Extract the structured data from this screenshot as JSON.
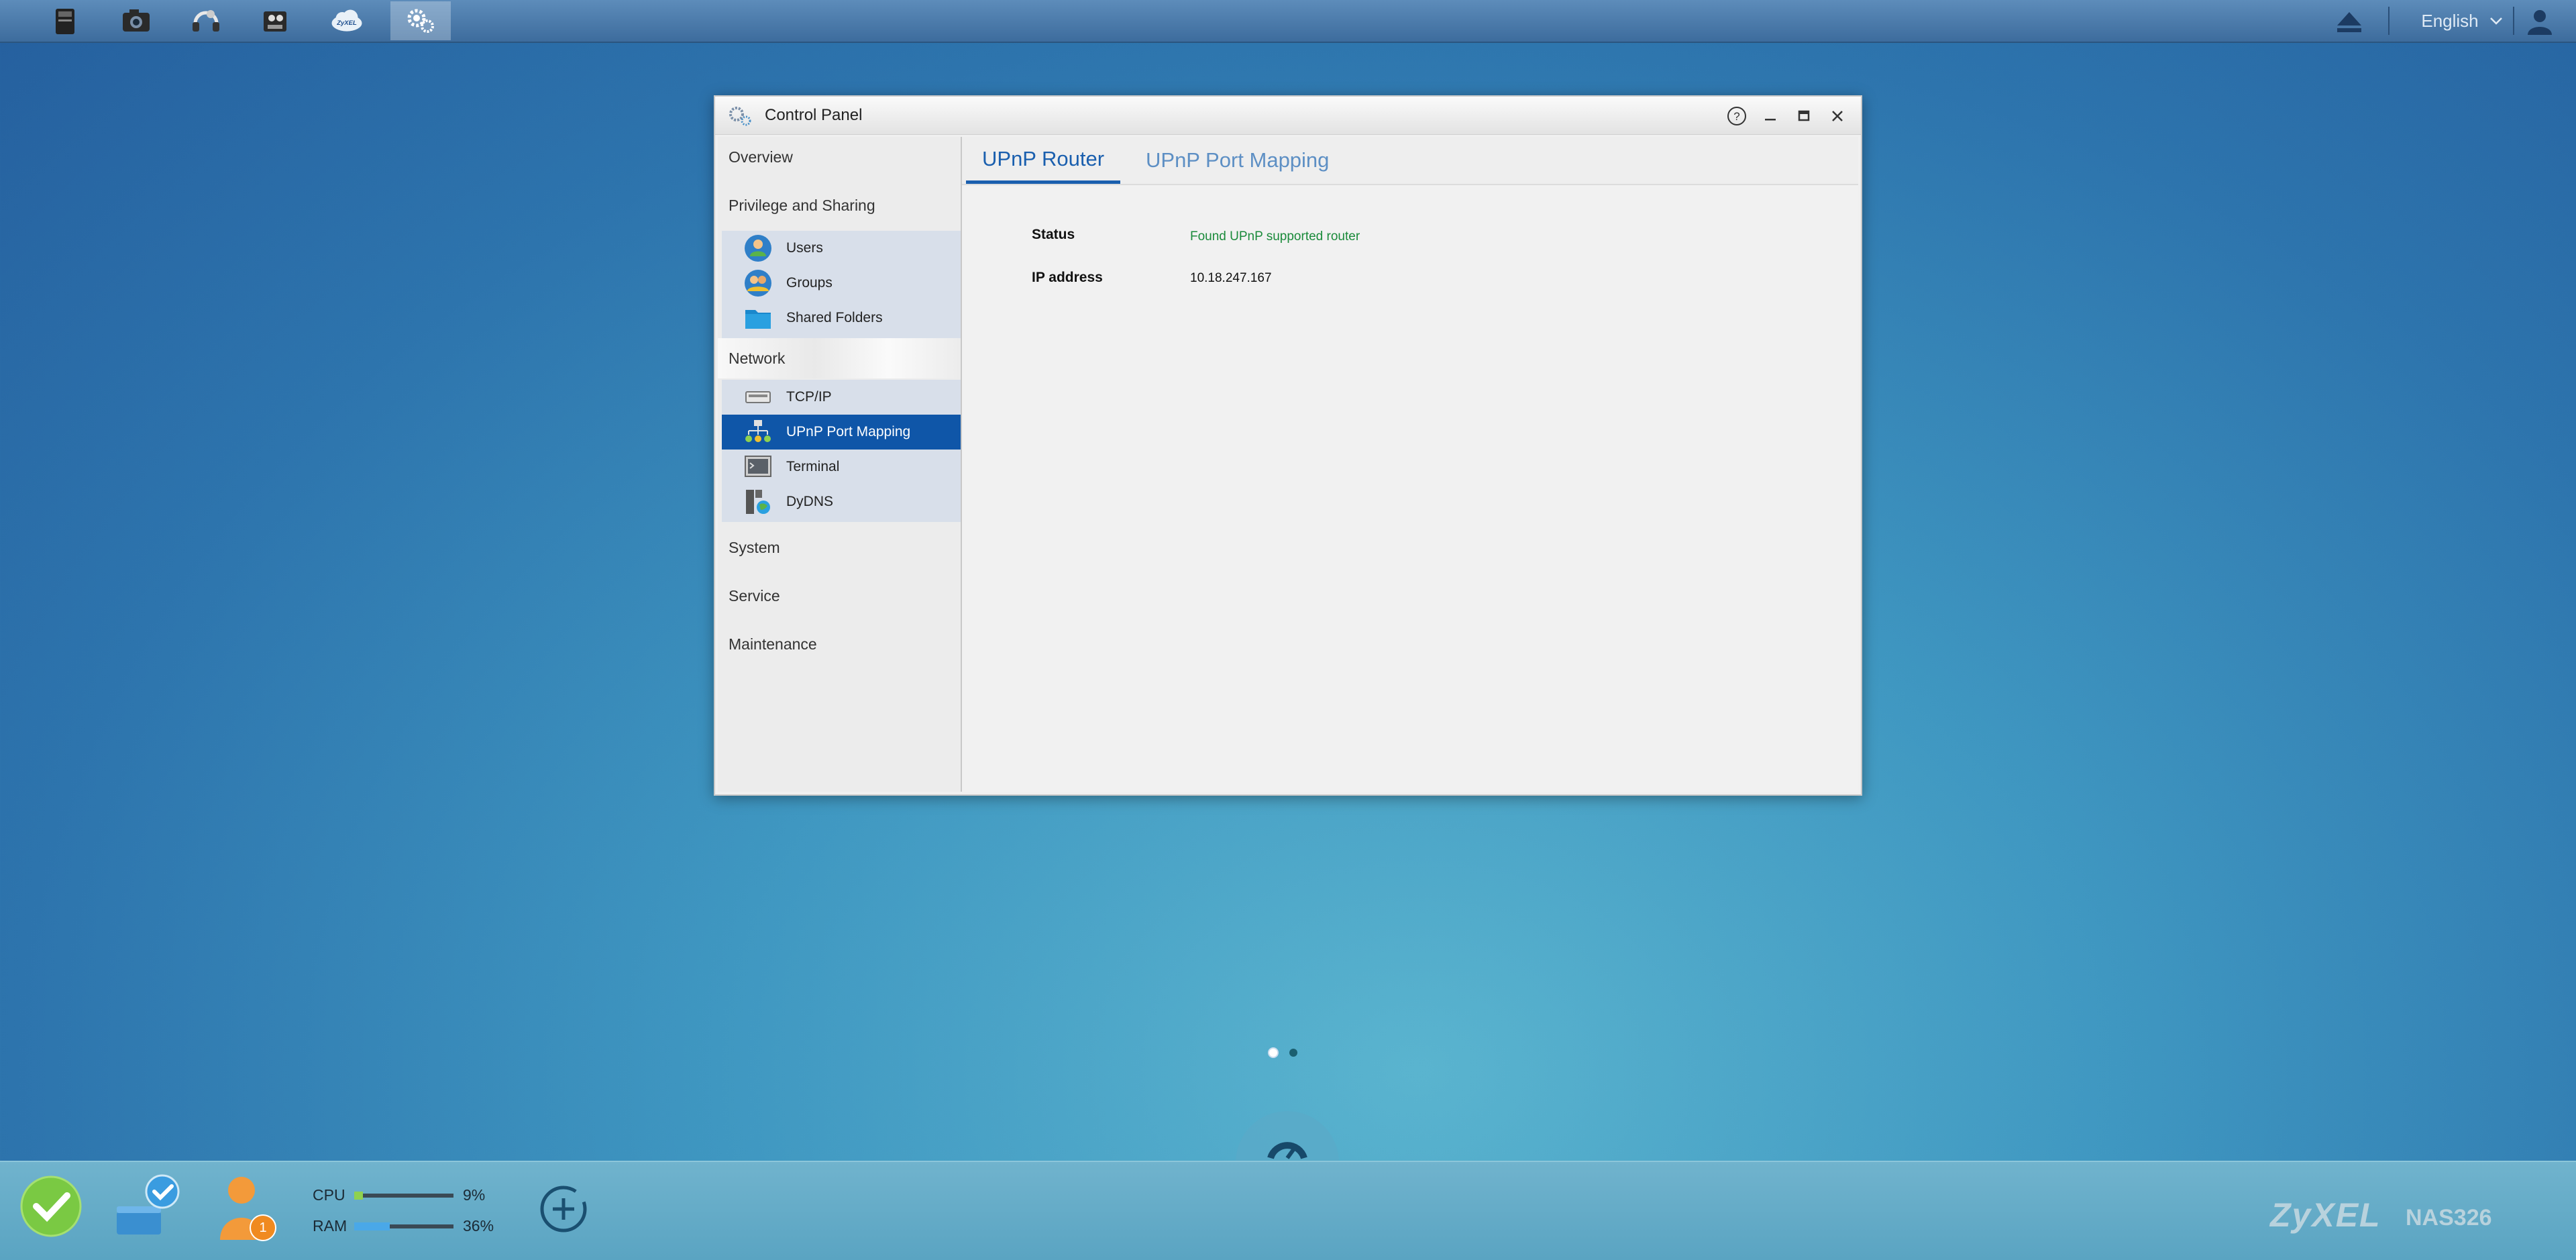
{
  "topbar": {
    "apps": [
      {
        "icon": "file-browser-icon"
      },
      {
        "icon": "photo-icon"
      },
      {
        "icon": "music-icon"
      },
      {
        "icon": "video-icon"
      },
      {
        "icon": "zyxel-cloud-icon",
        "label": "ZyXEL"
      },
      {
        "icon": "control-panel-gear-icon",
        "active": true
      }
    ],
    "language": "English"
  },
  "window": {
    "title": "Control Panel",
    "sidebar": {
      "categories": [
        "Overview",
        "Privilege and Sharing",
        "Network",
        "System",
        "Service",
        "Maintenance"
      ],
      "privilege_items": [
        "Users",
        "Groups",
        "Shared Folders"
      ],
      "network_items": [
        "TCP/IP",
        "UPnP Port Mapping",
        "Terminal",
        "DyDNS"
      ],
      "selected": "UPnP Port Mapping"
    },
    "tabs": [
      "UPnP Router",
      "UPnP Port Mapping"
    ],
    "active_tab": "UPnP Router",
    "fields": {
      "status_label": "Status",
      "status_value": "Found UPnP supported router",
      "ip_label": "IP address",
      "ip_value": "10.18.247.167"
    }
  },
  "bottombar": {
    "cpu": {
      "label": "CPU",
      "value_text": "9%",
      "percent": 9
    },
    "ram": {
      "label": "RAM",
      "value_text": "36%",
      "percent": 36
    },
    "user_badge": "1",
    "brand": "ZyXEL",
    "model": "NAS326"
  },
  "colors": {
    "accent": "#0f56a8",
    "status_green": "#1a8a3a",
    "cpu_fill": "#8fd14f",
    "ram_fill": "#4aa8e8"
  }
}
